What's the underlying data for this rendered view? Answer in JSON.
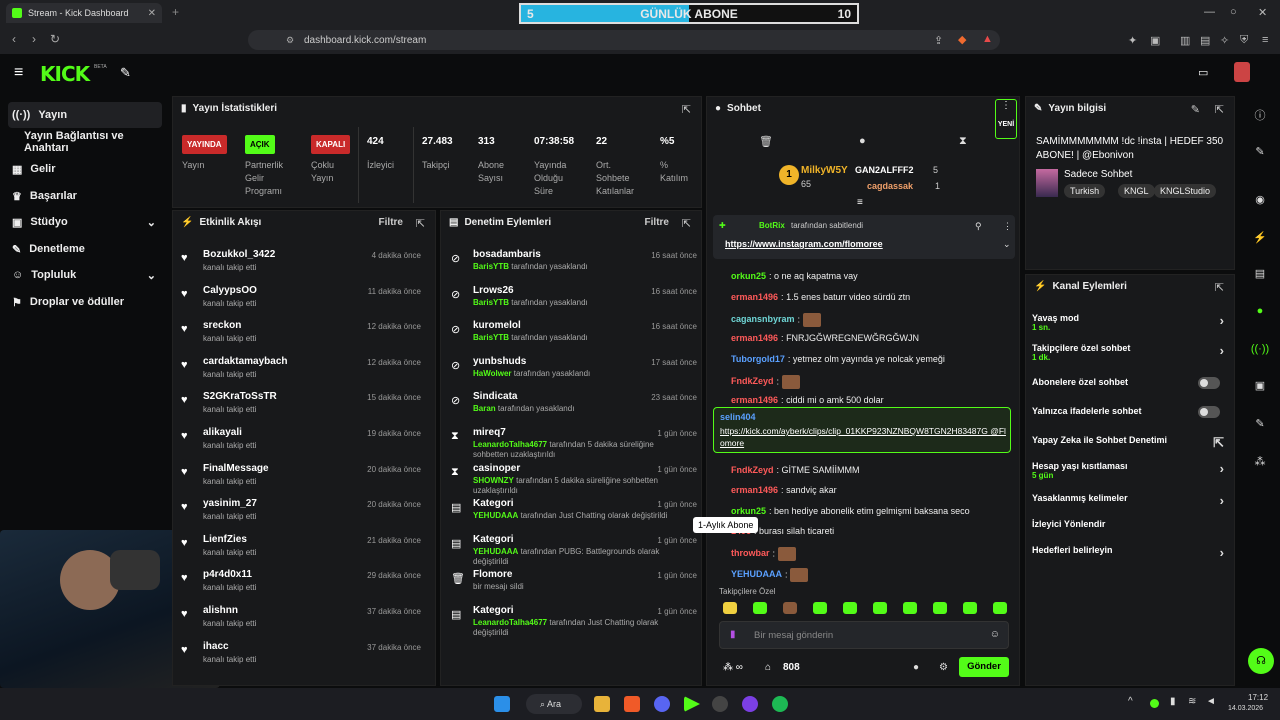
{
  "browser": {
    "tab_title": "Stream - Kick Dashboard",
    "url": "dashboard.kick.com/stream"
  },
  "goal": {
    "current": "5",
    "label": "GÜNLÜK ABONE",
    "target": "10",
    "progress": 0.5
  },
  "brand": {
    "logo": "KICK",
    "beta": "BETA"
  },
  "sidebar": {
    "items": [
      {
        "label": "Yayın",
        "icon": "broadcast-icon"
      },
      {
        "label": "Yayın Bağlantısı ve Anahtarı",
        "icon": ""
      },
      {
        "label": "Gelir",
        "icon": "chart-icon"
      },
      {
        "label": "Başarılar",
        "icon": "trophy-icon"
      },
      {
        "label": "Stüdyo",
        "icon": "studio-icon"
      },
      {
        "label": "Denetleme",
        "icon": "wrench-icon"
      },
      {
        "label": "Topluluk",
        "icon": "community-icon"
      },
      {
        "label": "Droplar ve ödüller",
        "icon": "drops-icon"
      }
    ]
  },
  "stats": {
    "title": "Yayın İstatistikleri",
    "cols": [
      {
        "badge": "YAYINDA",
        "label": "Yayın"
      },
      {
        "badge": "AÇIK",
        "label": "Partnerlik Gelir Programı"
      },
      {
        "badge": "KAPALI",
        "label": "Çoklu Yayın"
      },
      {
        "value": "424",
        "label": "İzleyici"
      },
      {
        "value": "27.483",
        "label": "Takipçi"
      },
      {
        "value": "313",
        "label": "Abone Sayısı"
      },
      {
        "value": "07:38:58",
        "label": "Yayında Olduğu Süre"
      },
      {
        "value": "22",
        "label": "Ort. Sohbete Katılanlar"
      },
      {
        "value": "%5",
        "label": "% Katılım"
      }
    ]
  },
  "feed": {
    "title": "Etkinlik Akışı",
    "filter": "Filtre",
    "items": [
      {
        "name": "Bozukkol_3422",
        "sub": "kanalı takip etti",
        "time": "4 dakika önce"
      },
      {
        "name": "CalyypsOO",
        "sub": "kanalı takip etti",
        "time": "11 dakika önce"
      },
      {
        "name": "sreckon",
        "sub": "kanalı takip etti",
        "time": "12 dakika önce"
      },
      {
        "name": "cardaktamaybach",
        "sub": "kanalı takip etti",
        "time": "12 dakika önce"
      },
      {
        "name": "S2GKraToSsTR",
        "sub": "kanalı takip etti",
        "time": "15 dakika önce"
      },
      {
        "name": "alikayali",
        "sub": "kanalı takip etti",
        "time": "19 dakika önce"
      },
      {
        "name": "FinalMessage",
        "sub": "kanalı takip etti",
        "time": "20 dakika önce"
      },
      {
        "name": "yasinim_27",
        "sub": "kanalı takip etti",
        "time": "20 dakika önce"
      },
      {
        "name": "LienfZies",
        "sub": "kanalı takip etti",
        "time": "21 dakika önce"
      },
      {
        "name": "p4r4d0x11",
        "sub": "kanalı takip etti",
        "time": "29 dakika önce"
      },
      {
        "name": "alishnn",
        "sub": "kanalı takip etti",
        "time": "37 dakika önce"
      },
      {
        "name": "ihacc",
        "sub": "kanalı takip etti",
        "time": "37 dakika önce"
      }
    ]
  },
  "mod": {
    "title": "Denetim Eylemleri",
    "filter": "Filtre",
    "items": [
      {
        "icon": "ban-icon",
        "name": "bosadambaris",
        "by": "BarisYTB",
        "rest": "tarafından yasaklandı",
        "time": "16 saat önce"
      },
      {
        "icon": "ban-icon",
        "name": "Lrows26",
        "by": "BarisYTB",
        "rest": "tarafından yasaklandı",
        "time": "16 saat önce"
      },
      {
        "icon": "ban-icon",
        "name": "kuromelol",
        "by": "BarisYTB",
        "rest": "tarafından yasaklandı",
        "time": "16 saat önce"
      },
      {
        "icon": "ban-icon",
        "name": "yunbshuds",
        "by": "HaWolwer",
        "rest": "tarafından yasaklandı",
        "time": "17 saat önce"
      },
      {
        "icon": "ban-icon",
        "name": "Sindicata",
        "by": "Baran",
        "rest": "tarafından yasaklandı",
        "time": "23 saat önce"
      },
      {
        "icon": "hourglass-icon",
        "name": "mireq7",
        "by": "LeanardoTalha4677",
        "rest": "tarafından 5 dakika süreliğine sohbetten uzaklaştırıldı",
        "time": "1 gün önce"
      },
      {
        "icon": "hourglass-icon",
        "name": "casinoper",
        "by": "SHOWNZY",
        "rest": "tarafından 5 dakika süreliğine sohbetten uzaklaştırıldı",
        "time": "1 gün önce"
      },
      {
        "icon": "category-icon",
        "name": "Kategori",
        "by": "YEHUDAAA",
        "rest": "tarafından Just Chatting olarak değiştirildi",
        "time": "1 gün önce"
      },
      {
        "icon": "category-icon",
        "name": "Kategori",
        "by": "YEHUDAAA",
        "rest": "tarafından PUBG: Battlegrounds olarak değiştirildi",
        "time": "1 gün önce"
      },
      {
        "icon": "trash-icon",
        "name": "Flomore",
        "by": "",
        "rest": "bir mesajı sildi",
        "time": "1 gün önce"
      },
      {
        "icon": "category-icon",
        "name": "Kategori",
        "by": "LeanardoTalha4677",
        "rest": "tarafından Just Chatting olarak değiştirildi",
        "time": "1 gün önce"
      }
    ]
  },
  "chat": {
    "title": "Sohbet",
    "new_label": "YENİ",
    "top": {
      "first": "MilkyW5Y",
      "first_count": "65",
      "second": "GAN2ALFFF2",
      "second_count": "5",
      "third": "cagdassak",
      "third_count": "1"
    },
    "pinned": {
      "by": "BotRix",
      "by_text": "tarafından sabitlendi",
      "link": "https://www.instagram.com/flomoree"
    },
    "messages": [
      {
        "user": "orkun25",
        "color": "#53fc18",
        "text": "o ne aq kapatma vay"
      },
      {
        "user": "erman1496",
        "color": "#ff5a5a",
        "text": "1.5 enes baturr video sürdü ztn"
      },
      {
        "user": "cagansnbyram",
        "color": "#6fd6d6",
        "text": ""
      },
      {
        "user": "erman1496",
        "color": "#ff5a5a",
        "text": "FNRJGĞWREGNEWĞRGĞWJN"
      },
      {
        "user": "Tuborgold17",
        "color": "#5aa0ff",
        "text": "yetmez olm yayında ye nolcak yemeği"
      },
      {
        "user": "FndkZeyd",
        "color": "#ff5a5a",
        "text": ""
      },
      {
        "user": "erman1496",
        "color": "#ff5a5a",
        "text": "ciddi mi o amk 500 dolar"
      },
      {
        "user": "FndkZeyd",
        "color": "#ff5a5a",
        "text": "GİTME SAMİİMMM"
      },
      {
        "user": "erman1496",
        "color": "#ff5a5a",
        "text": "sandviç akar"
      },
      {
        "user": "orkun25",
        "color": "#53fc18",
        "text": "ben hediye abonelik etim gelmişmi baksana seco"
      },
      {
        "user": "1496",
        "color": "#ff5a5a",
        "text": "burası silah ticareti"
      },
      {
        "user": "throwbar",
        "color": "#ff5a5a",
        "text": ""
      },
      {
        "user": "YEHUDAAA",
        "color": "#5aa0ff",
        "text": ""
      }
    ],
    "highlight": {
      "user": "selin404",
      "text": "https://kick.com/ayberk/clips/clip_01KKP923NZNBQW8TGN2H83487G @Flomore"
    },
    "tooltip": "1-Aylık Abone",
    "followers_only": "Takipçilere Özel",
    "placeholder": "Bir mesaj gönderin",
    "count": "808",
    "send": "Gönder"
  },
  "info": {
    "title": "Yayın bilgisi",
    "stream_title": "SAMİMMMMMMM !dc !insta | HEDEF 350 ABONE! | @Ebonivon",
    "category": "Sadece Sohbet",
    "tags": [
      "Turkish",
      "KNGL",
      "KNGLStudio"
    ]
  },
  "actions": {
    "title": "Kanal Eylemleri",
    "items": [
      {
        "label": "Yavaş mod",
        "sub": "1 sn.",
        "type": "arrow"
      },
      {
        "label": "Takipçilere özel sohbet",
        "sub": "1 dk.",
        "type": "arrow"
      },
      {
        "label": "Abonelere özel sohbet",
        "sub": "",
        "type": "toggle"
      },
      {
        "label": "Yalnızca ifadelerle sohbet",
        "sub": "",
        "type": "toggle"
      },
      {
        "label": "Yapay Zeka ile Sohbet Denetimi",
        "sub": "",
        "type": "link"
      },
      {
        "label": "Hesap yaşı kısıtlaması",
        "sub": "5 gün",
        "type": "arrow"
      },
      {
        "label": "Yasaklanmış kelimeler",
        "sub": "",
        "type": "arrow"
      },
      {
        "label": "İzleyici Yönlendir",
        "sub": "",
        "type": "none"
      },
      {
        "label": "Hedefleri belirleyin",
        "sub": "",
        "type": "arrow"
      }
    ]
  },
  "taskbar": {
    "search": "Ara",
    "time": "17:12",
    "date": "14.03.2026"
  },
  "colors": {
    "accent": "#53fc18",
    "bg": "#0b0c0d",
    "panel": "#18191b"
  }
}
